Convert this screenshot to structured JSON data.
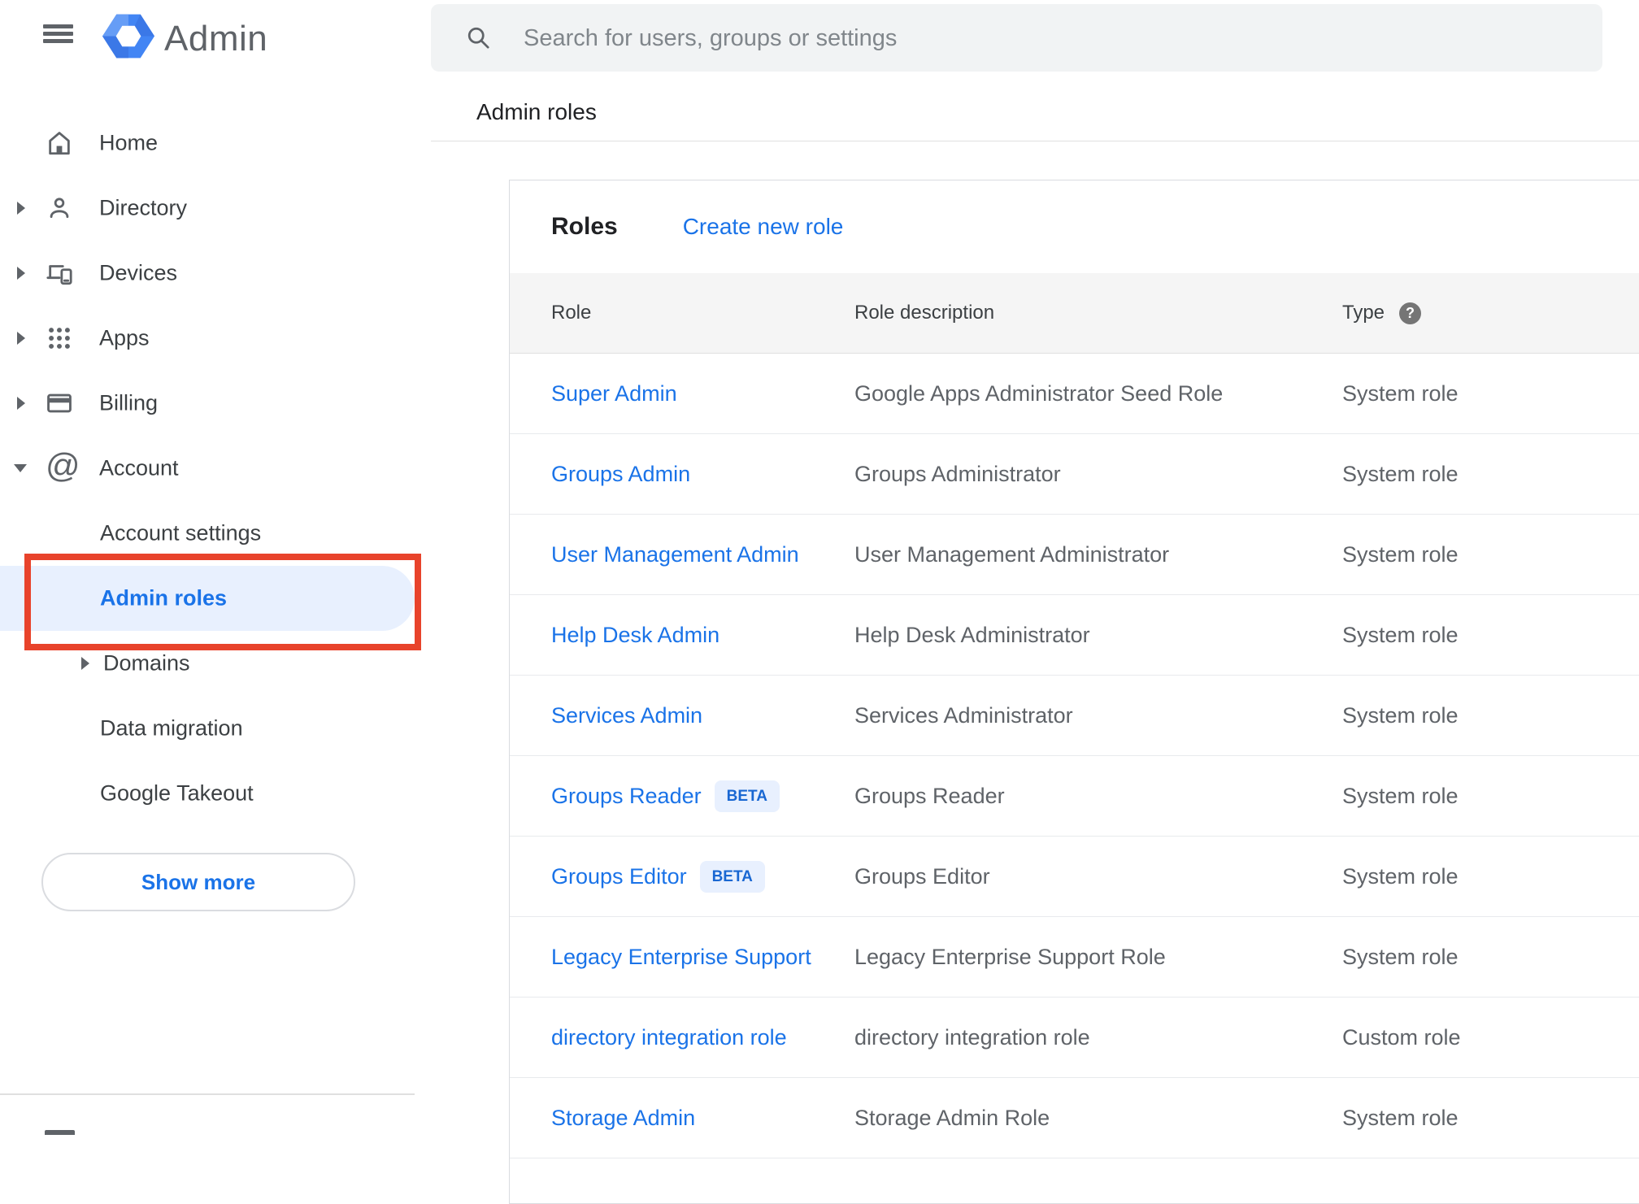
{
  "header": {
    "product_name": "Admin",
    "search_placeholder": "Search for users, groups or settings"
  },
  "sidebar": {
    "items": [
      {
        "label": "Home",
        "icon": "home-icon",
        "expander": "none",
        "level": "top"
      },
      {
        "label": "Directory",
        "icon": "directory-icon",
        "expander": "right",
        "level": "top"
      },
      {
        "label": "Devices",
        "icon": "devices-icon",
        "expander": "right",
        "level": "top"
      },
      {
        "label": "Apps",
        "icon": "apps-icon",
        "expander": "right",
        "level": "top"
      },
      {
        "label": "Billing",
        "icon": "billing-icon",
        "expander": "right",
        "level": "top"
      },
      {
        "label": "Account",
        "icon": "account-icon",
        "expander": "down",
        "level": "top"
      },
      {
        "label": "Account settings",
        "expander": "none",
        "level": "sub"
      },
      {
        "label": "Admin roles",
        "expander": "none",
        "level": "sub",
        "selected": true
      },
      {
        "label": "Domains",
        "expander": "right",
        "level": "sub"
      },
      {
        "label": "Data migration",
        "expander": "none",
        "level": "sub"
      },
      {
        "label": "Google Takeout",
        "expander": "none",
        "level": "sub"
      }
    ],
    "show_more_label": "Show more"
  },
  "page": {
    "title": "Admin roles"
  },
  "roles_card": {
    "heading": "Roles",
    "create_link": "Create new role",
    "columns": [
      "Role",
      "Role description",
      "Type"
    ],
    "help_glyph": "?",
    "beta_label": "BETA",
    "rows": [
      {
        "role": "Super Admin",
        "beta": false,
        "description": "Google Apps Administrator Seed Role",
        "type": "System role"
      },
      {
        "role": "Groups Admin",
        "beta": false,
        "description": "Groups Administrator",
        "type": "System role"
      },
      {
        "role": "User Management Admin",
        "beta": false,
        "description": "User Management Administrator",
        "type": "System role"
      },
      {
        "role": "Help Desk Admin",
        "beta": false,
        "description": "Help Desk Administrator",
        "type": "System role"
      },
      {
        "role": "Services Admin",
        "beta": false,
        "description": "Services Administrator",
        "type": "System role"
      },
      {
        "role": "Groups Reader",
        "beta": true,
        "description": "Groups Reader",
        "type": "System role"
      },
      {
        "role": "Groups Editor",
        "beta": true,
        "description": "Groups Editor",
        "type": "System role"
      },
      {
        "role": "Legacy Enterprise Support",
        "beta": false,
        "description": "Legacy Enterprise Support Role",
        "type": "System role"
      },
      {
        "role": "directory integration role",
        "beta": false,
        "description": "directory integration role",
        "type": "Custom role"
      },
      {
        "role": "Storage Admin",
        "beta": false,
        "description": "Storage Admin Role",
        "type": "System role"
      }
    ]
  },
  "colors": {
    "accent_blue": "#1a73e8",
    "selected_pill_bg": "#e8f0fe",
    "beta_badge_bg": "#e8f0fe",
    "beta_badge_text": "#1967d2",
    "annotation_red": "#e8432b",
    "search_bg": "#f1f3f4",
    "table_header_bg": "#f5f5f5",
    "text_dark": "#202124",
    "text_gray": "#5f6368",
    "logo_blue": "#4285f4"
  }
}
